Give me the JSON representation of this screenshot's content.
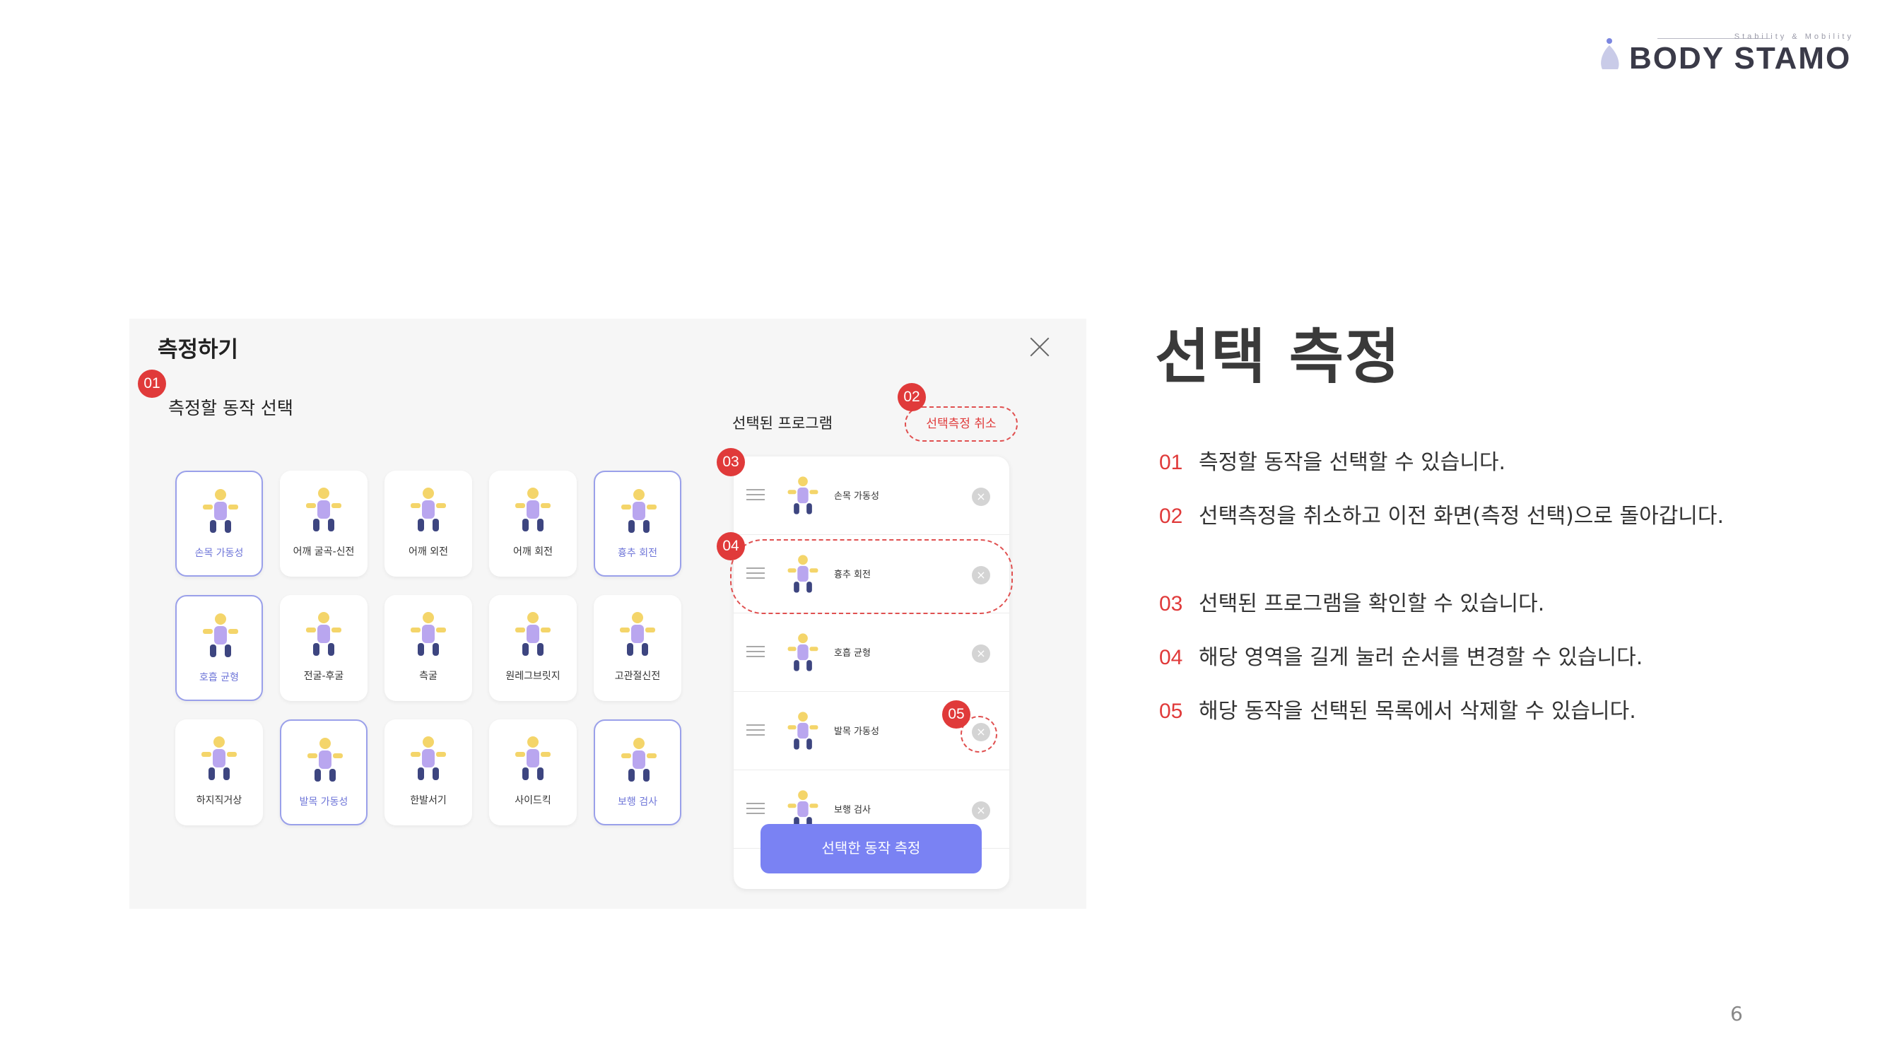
{
  "logo": {
    "tagline": "Stability & Mobility",
    "wordmark": "BODY STAMO"
  },
  "dialog": {
    "title": "측정하기",
    "section_title": "측정할 동작 선택",
    "exercises": [
      {
        "label": "손목 가동성",
        "selected": true
      },
      {
        "label": "어깨 굴곡-신전",
        "selected": false
      },
      {
        "label": "어깨 외전",
        "selected": false
      },
      {
        "label": "어깨 회전",
        "selected": false
      },
      {
        "label": "흉추 회전",
        "selected": true
      },
      {
        "label": "호흡 균형",
        "selected": true
      },
      {
        "label": "전굴-후굴",
        "selected": false
      },
      {
        "label": "측굴",
        "selected": false
      },
      {
        "label": "원레그브릿지",
        "selected": false
      },
      {
        "label": "고관절신전",
        "selected": false
      },
      {
        "label": "하지직거상",
        "selected": false
      },
      {
        "label": "발목 가동성",
        "selected": true
      },
      {
        "label": "한발서기",
        "selected": false
      },
      {
        "label": "사이드킥",
        "selected": false
      },
      {
        "label": "보행 검사",
        "selected": true
      }
    ],
    "program_title": "선택된 프로그램",
    "cancel_label": "선택측정 취소",
    "program_items": [
      "손목 가동성",
      "흉추 회전",
      "호흡 균형",
      "발목 가동성",
      "보행 검사"
    ],
    "measure_button": "선택한 동작 측정",
    "delete_glyph": "×"
  },
  "badges": [
    "01",
    "02",
    "03",
    "04",
    "05"
  ],
  "heading": "선택 측정",
  "descriptions": [
    {
      "num": "01",
      "text": "측정할 동작을 선택할 수 있습니다."
    },
    {
      "num": "02",
      "text": "선택측정을 취소하고 이전 화면(측정 선택)으로 돌아갑니다."
    },
    {
      "num": "03",
      "text": "선택된 프로그램을 확인할 수 있습니다."
    },
    {
      "num": "04",
      "text": "해당 영역을 길게 눌러 순서를 변경할 수 있습니다."
    },
    {
      "num": "05",
      "text": "해당 동작을 선택된 목록에서 삭제할 수 있습니다."
    }
  ],
  "page_number": "6",
  "colors": {
    "accent_red": "#e03a3a",
    "button_purple": "#7a82f3",
    "figure_yellow": "#f4d56a",
    "figure_purple": "#b9a6ef"
  }
}
